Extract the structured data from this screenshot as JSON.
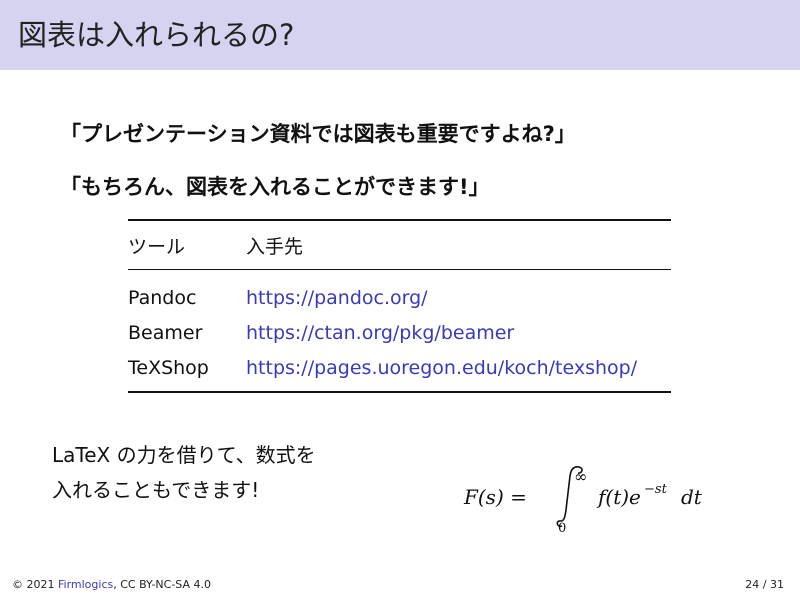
{
  "slide": {
    "title": "図表は入れられるの?",
    "quote1": "「プレゼンテーション資料では図表も重要ですよね?」",
    "quote2": "「もちろん、図表を入れることができます!」"
  },
  "table": {
    "headers": [
      "ツール",
      "入手先"
    ],
    "rows": [
      {
        "tool": "Pandoc",
        "url": "https://pandoc.org/"
      },
      {
        "tool": "Beamer",
        "url": "https://ctan.org/pkg/beamer"
      },
      {
        "tool": "TeXShop",
        "url": "https://pages.uoregon.edu/koch/texshop/"
      }
    ]
  },
  "body": {
    "line1": "LaTeX の力を借りて、数式を",
    "line2": "入れることもできます!"
  },
  "formula": {
    "lhs": "F(s) =",
    "upper": "∞",
    "lower": "0",
    "integrand": "f(t)e",
    "exponent": "−st",
    "differential": "dt"
  },
  "footer": {
    "copyright": "© 2021",
    "brand": "Firmlogics",
    "license": "CC BY-NC-SA 4.0",
    "page": "24 / 31"
  },
  "colors": {
    "title_bar": "#d4d4f0",
    "link": "#3a3ab8"
  }
}
